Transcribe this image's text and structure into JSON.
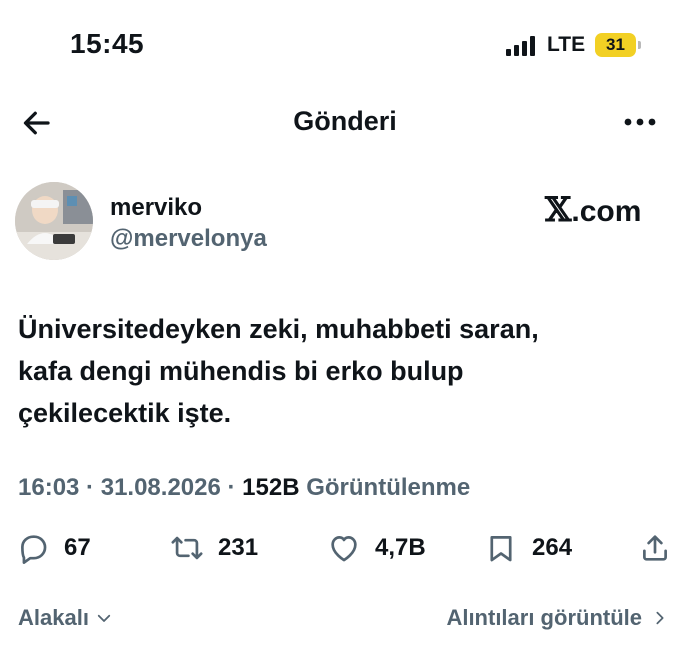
{
  "status_bar": {
    "time": "15:45",
    "network": "LTE",
    "battery": "31",
    "battery_color": "#f2d024"
  },
  "nav": {
    "title": "Gönderi",
    "back_icon": "arrow-left-icon",
    "more_icon": "more-horizontal-icon"
  },
  "post": {
    "author": {
      "display_name": "merviko",
      "handle": "@mervelonya"
    },
    "watermark": {
      "mark": "𝕏",
      "text": ".com"
    },
    "text_lines": [
      "Üniversitedeyken zeki, muhabbeti saran,",
      "kafa dengi mühendis bi erko bulup",
      "çekilecektik işte."
    ],
    "meta": {
      "time": "16:03",
      "sep1": " · ",
      "date": "31.08.2026",
      "sep2": " · ",
      "views_count": "152B",
      "views_label": " Görüntülenme"
    },
    "actions": {
      "replies": "67",
      "reposts": "231",
      "likes": "4,7B",
      "bookmarks": "264"
    }
  },
  "footer": {
    "sort_label": "Alakalı",
    "quotes_label": "Alıntıları görüntüle"
  },
  "colors": {
    "text_primary": "#0f1419",
    "text_secondary": "#536471",
    "background": "#ffffff"
  }
}
